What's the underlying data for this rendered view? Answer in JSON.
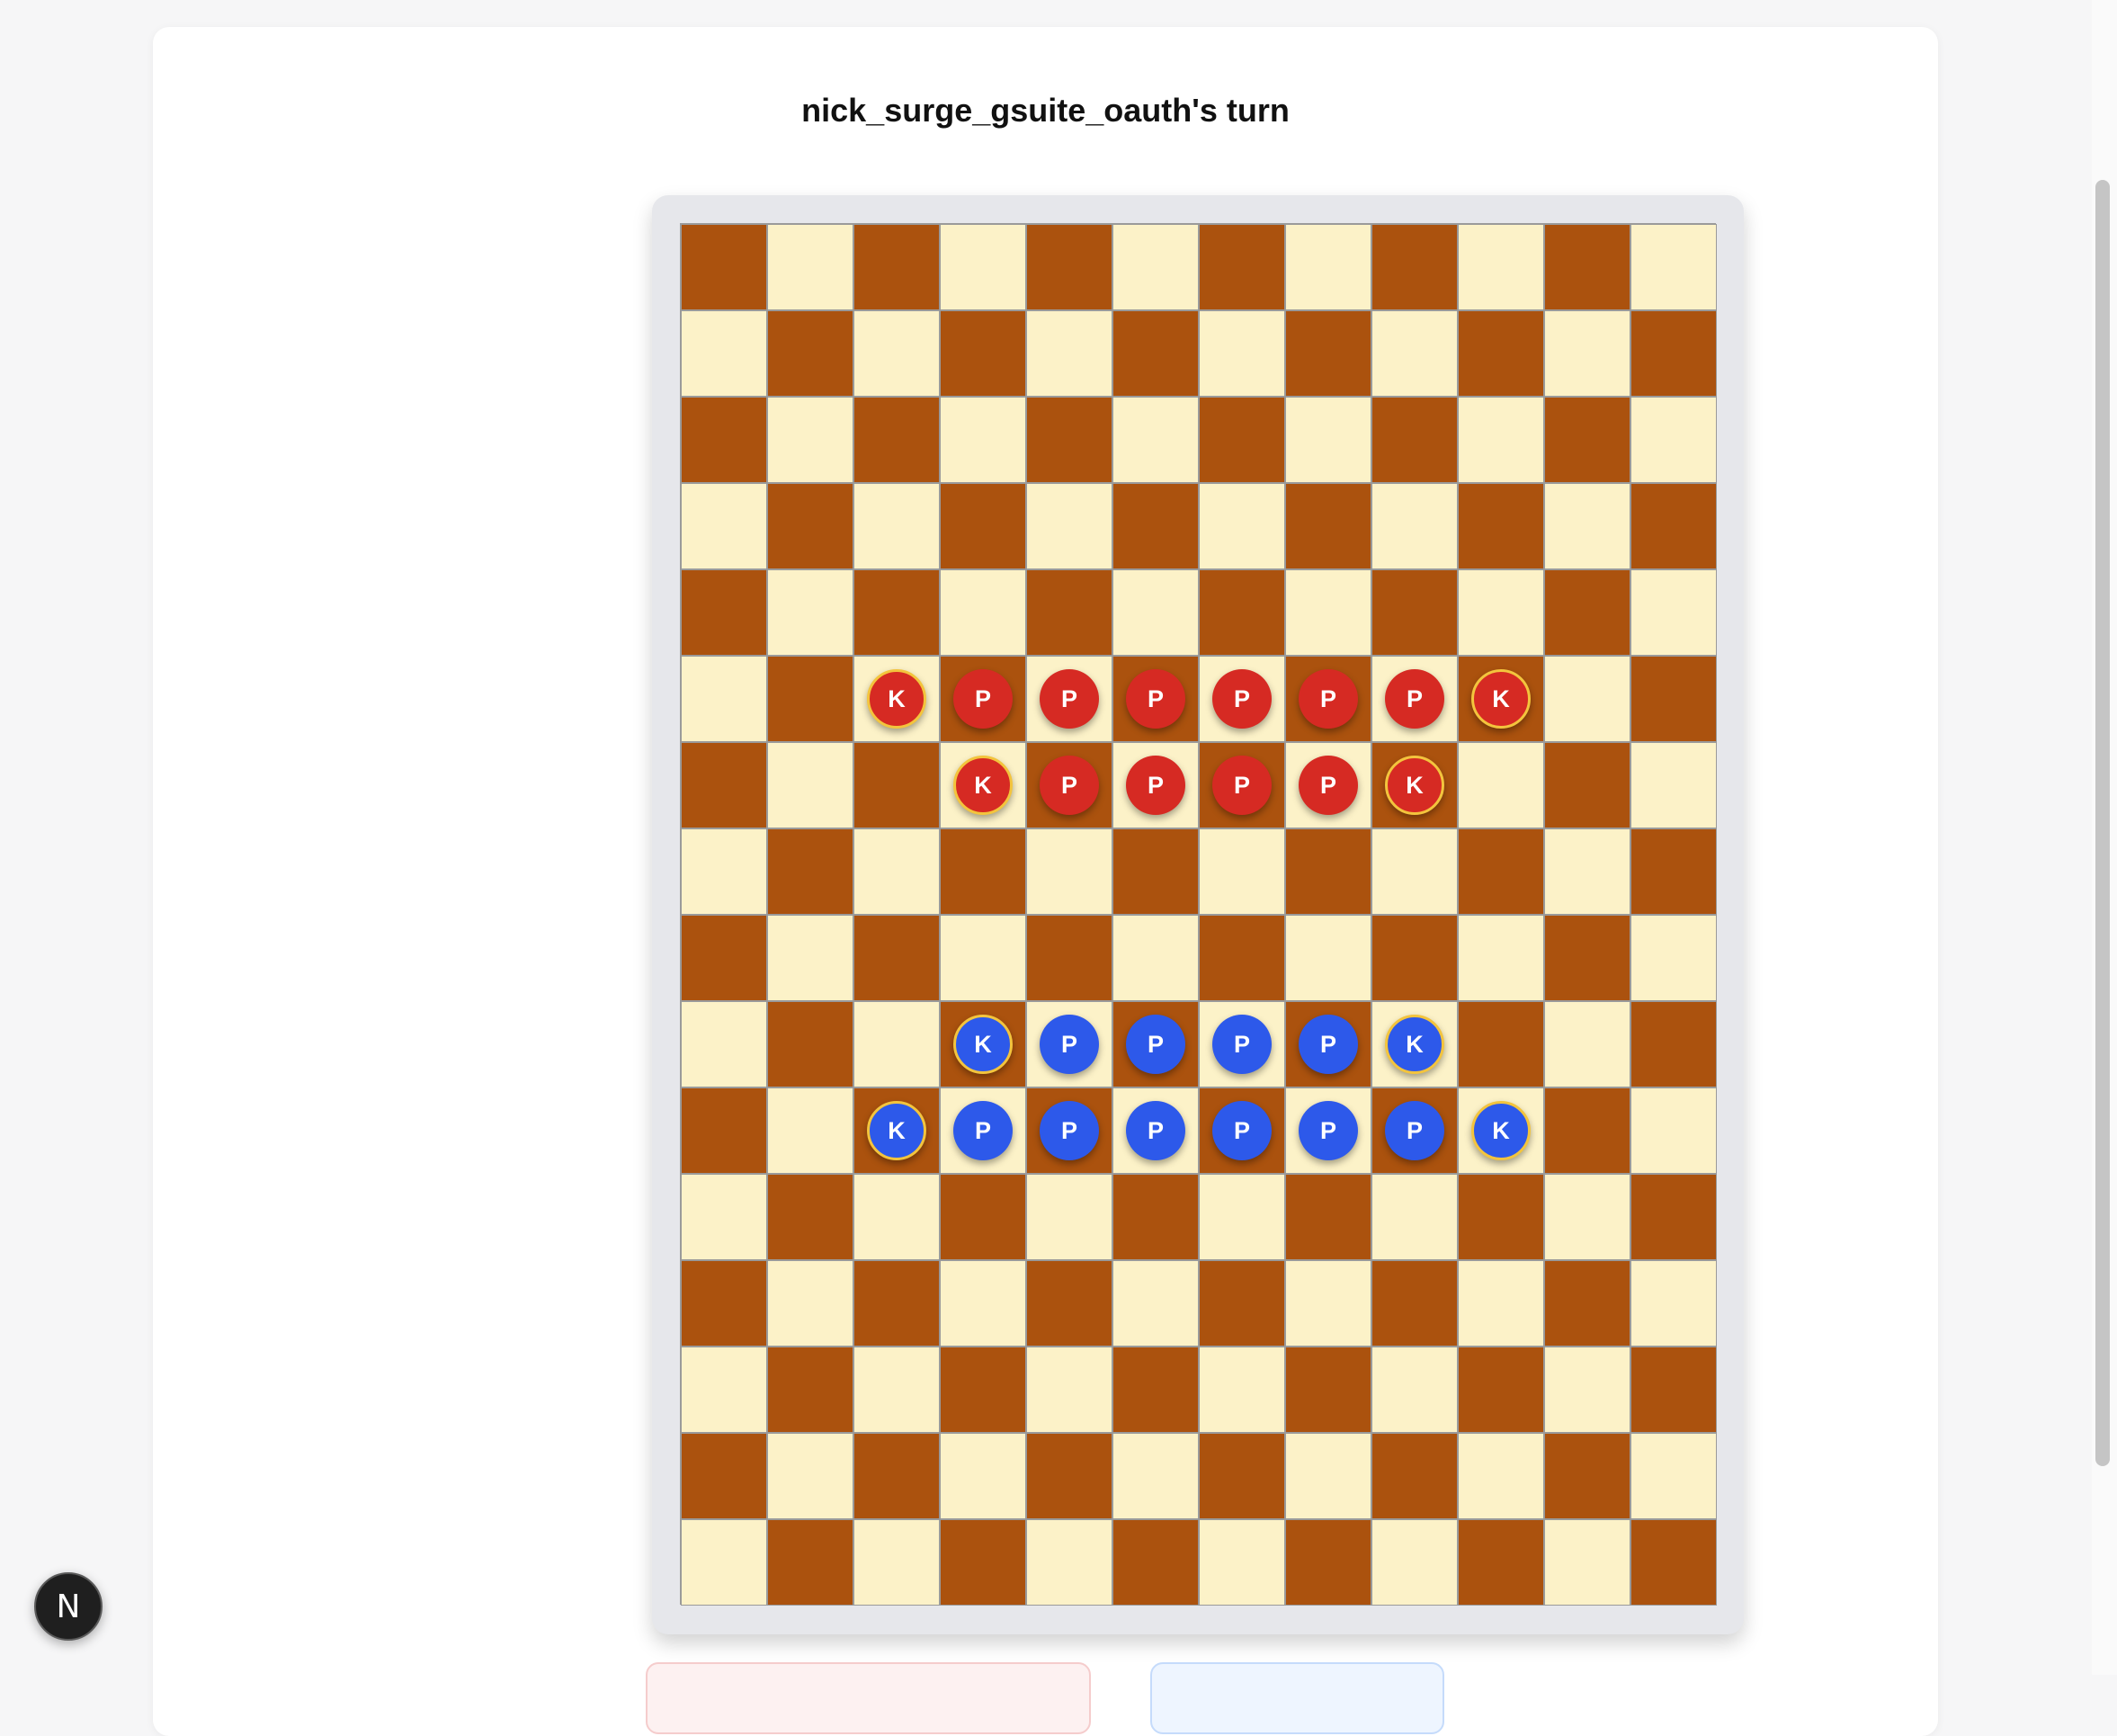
{
  "game": {
    "turn_title": "nick_surge_gsuite_oauth's turn"
  },
  "board": {
    "rows": 16,
    "cols": 12,
    "dark_color": "#ab520e",
    "light_color": "#fcf2c8",
    "pieces": [
      {
        "row": 5,
        "col": 2,
        "color": "red",
        "label": "K"
      },
      {
        "row": 5,
        "col": 3,
        "color": "red",
        "label": "P"
      },
      {
        "row": 5,
        "col": 4,
        "color": "red",
        "label": "P"
      },
      {
        "row": 5,
        "col": 5,
        "color": "red",
        "label": "P"
      },
      {
        "row": 5,
        "col": 6,
        "color": "red",
        "label": "P"
      },
      {
        "row": 5,
        "col": 7,
        "color": "red",
        "label": "P"
      },
      {
        "row": 5,
        "col": 8,
        "color": "red",
        "label": "P"
      },
      {
        "row": 5,
        "col": 9,
        "color": "red",
        "label": "K"
      },
      {
        "row": 6,
        "col": 3,
        "color": "red",
        "label": "K"
      },
      {
        "row": 6,
        "col": 4,
        "color": "red",
        "label": "P"
      },
      {
        "row": 6,
        "col": 5,
        "color": "red",
        "label": "P"
      },
      {
        "row": 6,
        "col": 6,
        "color": "red",
        "label": "P"
      },
      {
        "row": 6,
        "col": 7,
        "color": "red",
        "label": "P"
      },
      {
        "row": 6,
        "col": 8,
        "color": "red",
        "label": "K"
      },
      {
        "row": 9,
        "col": 3,
        "color": "blue",
        "label": "K"
      },
      {
        "row": 9,
        "col": 4,
        "color": "blue",
        "label": "P"
      },
      {
        "row": 9,
        "col": 5,
        "color": "blue",
        "label": "P"
      },
      {
        "row": 9,
        "col": 6,
        "color": "blue",
        "label": "P"
      },
      {
        "row": 9,
        "col": 7,
        "color": "blue",
        "label": "P"
      },
      {
        "row": 9,
        "col": 8,
        "color": "blue",
        "label": "K"
      },
      {
        "row": 10,
        "col": 2,
        "color": "blue",
        "label": "K"
      },
      {
        "row": 10,
        "col": 3,
        "color": "blue",
        "label": "P"
      },
      {
        "row": 10,
        "col": 4,
        "color": "blue",
        "label": "P"
      },
      {
        "row": 10,
        "col": 5,
        "color": "blue",
        "label": "P"
      },
      {
        "row": 10,
        "col": 6,
        "color": "blue",
        "label": "P"
      },
      {
        "row": 10,
        "col": 7,
        "color": "blue",
        "label": "P"
      },
      {
        "row": 10,
        "col": 8,
        "color": "blue",
        "label": "P"
      },
      {
        "row": 10,
        "col": 9,
        "color": "blue",
        "label": "K"
      }
    ]
  },
  "colors": {
    "red_piece": "#d62a23",
    "blue_piece": "#2d59ea",
    "king_ring": "#f3c43d"
  },
  "dev_badge": {
    "label": "N"
  }
}
